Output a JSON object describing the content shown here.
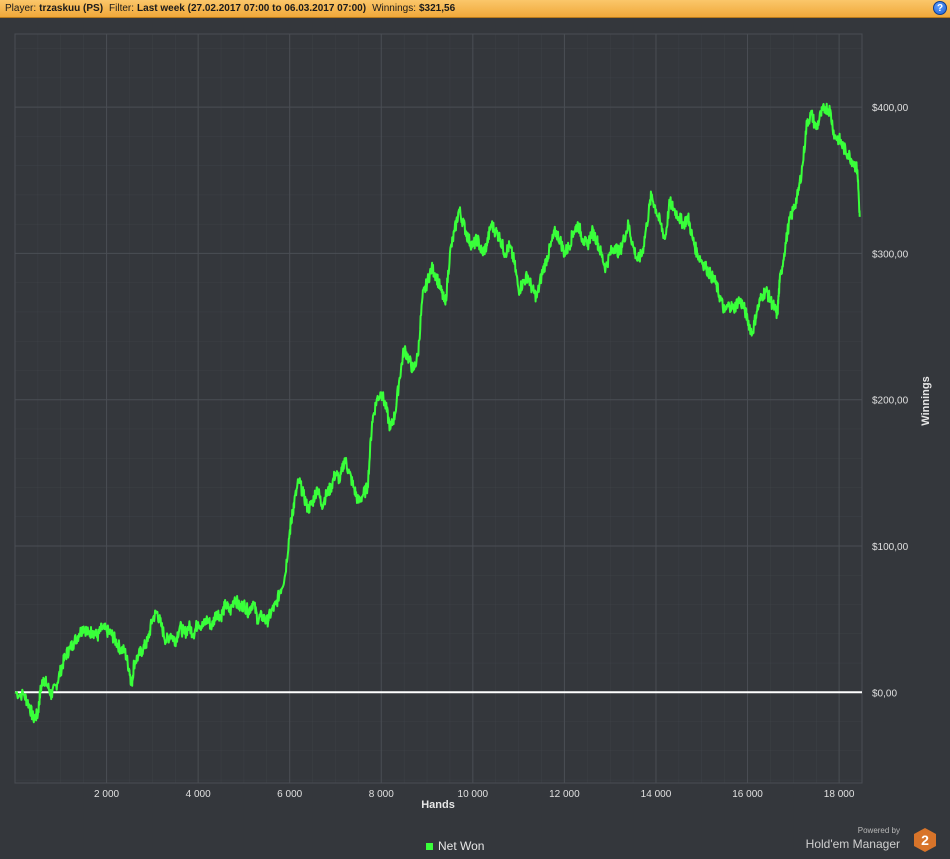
{
  "header": {
    "player_label": "Player:",
    "player_value": "trzaskuu (PS)",
    "filter_label": "Filter:",
    "filter_value": "Last week (27.02.2017 07:00 to 06.03.2017 07:00)",
    "winnings_label": "Winnings:",
    "winnings_value": "$321,56",
    "help_icon": "help-icon",
    "help_glyph": "?"
  },
  "colors": {
    "background": "#34373c",
    "grid": "#4a4e54",
    "line": "#39ff3a",
    "zero_line": "#ffffff",
    "header_bg": "#f0a83a"
  },
  "chart_data": {
    "type": "line",
    "xlabel": "Hands",
    "ylabel": "Winnings",
    "xlim": [
      0,
      18500
    ],
    "ylim": [
      -62,
      450
    ],
    "x_ticks": [
      2000,
      4000,
      6000,
      8000,
      10000,
      12000,
      14000,
      16000,
      18000
    ],
    "x_tick_labels": [
      "2 000",
      "4 000",
      "6 000",
      "8 000",
      "10 000",
      "12 000",
      "14 000",
      "16 000",
      "18 000"
    ],
    "y_ticks": [
      0,
      100,
      200,
      300,
      400
    ],
    "y_tick_labels": [
      "$0,00",
      "$100,00",
      "$200,00",
      "$300,00",
      "$400,00"
    ],
    "grid": true,
    "legend_position": "bottom-center",
    "series": [
      {
        "name": "Net Won",
        "color": "#39ff3a",
        "points": [
          [
            0,
            0
          ],
          [
            200,
            -2
          ],
          [
            300,
            -8
          ],
          [
            400,
            -18
          ],
          [
            500,
            -15
          ],
          [
            550,
            0
          ],
          [
            620,
            10
          ],
          [
            700,
            5
          ],
          [
            800,
            -2
          ],
          [
            900,
            5
          ],
          [
            1000,
            15
          ],
          [
            1100,
            25
          ],
          [
            1200,
            30
          ],
          [
            1300,
            35
          ],
          [
            1400,
            40
          ],
          [
            1500,
            45
          ],
          [
            1600,
            40
          ],
          [
            1700,
            42
          ],
          [
            1800,
            38
          ],
          [
            1900,
            44
          ],
          [
            2000,
            42
          ],
          [
            2100,
            40
          ],
          [
            2200,
            35
          ],
          [
            2300,
            30
          ],
          [
            2400,
            28
          ],
          [
            2500,
            15
          ],
          [
            2550,
            5
          ],
          [
            2600,
            20
          ],
          [
            2700,
            25
          ],
          [
            2800,
            30
          ],
          [
            2900,
            35
          ],
          [
            3000,
            50
          ],
          [
            3100,
            55
          ],
          [
            3200,
            45
          ],
          [
            3300,
            35
          ],
          [
            3400,
            40
          ],
          [
            3500,
            35
          ],
          [
            3600,
            45
          ],
          [
            3700,
            40
          ],
          [
            3800,
            45
          ],
          [
            3900,
            40
          ],
          [
            4000,
            48
          ],
          [
            4100,
            45
          ],
          [
            4200,
            50
          ],
          [
            4300,
            45
          ],
          [
            4400,
            55
          ],
          [
            4500,
            52
          ],
          [
            4600,
            60
          ],
          [
            4700,
            55
          ],
          [
            4800,
            65
          ],
          [
            4900,
            58
          ],
          [
            5000,
            60
          ],
          [
            5100,
            55
          ],
          [
            5200,
            62
          ],
          [
            5300,
            50
          ],
          [
            5400,
            52
          ],
          [
            5500,
            48
          ],
          [
            5600,
            55
          ],
          [
            5700,
            60
          ],
          [
            5800,
            70
          ],
          [
            5900,
            80
          ],
          [
            6000,
            110
          ],
          [
            6050,
            120
          ],
          [
            6100,
            130
          ],
          [
            6200,
            145
          ],
          [
            6300,
            135
          ],
          [
            6400,
            125
          ],
          [
            6500,
            130
          ],
          [
            6600,
            140
          ],
          [
            6700,
            128
          ],
          [
            6800,
            135
          ],
          [
            6900,
            140
          ],
          [
            7000,
            150
          ],
          [
            7100,
            145
          ],
          [
            7200,
            160
          ],
          [
            7300,
            150
          ],
          [
            7400,
            140
          ],
          [
            7500,
            130
          ],
          [
            7600,
            135
          ],
          [
            7700,
            140
          ],
          [
            7800,
            185
          ],
          [
            7900,
            200
          ],
          [
            8000,
            205
          ],
          [
            8100,
            195
          ],
          [
            8200,
            180
          ],
          [
            8300,
            190
          ],
          [
            8400,
            215
          ],
          [
            8500,
            235
          ],
          [
            8600,
            228
          ],
          [
            8700,
            220
          ],
          [
            8800,
            230
          ],
          [
            8900,
            270
          ],
          [
            9000,
            280
          ],
          [
            9100,
            290
          ],
          [
            9200,
            285
          ],
          [
            9300,
            275
          ],
          [
            9400,
            265
          ],
          [
            9500,
            300
          ],
          [
            9600,
            315
          ],
          [
            9700,
            330
          ],
          [
            9800,
            320
          ],
          [
            9900,
            310
          ],
          [
            10000,
            305
          ],
          [
            10100,
            310
          ],
          [
            10200,
            300
          ],
          [
            10300,
            305
          ],
          [
            10400,
            320
          ],
          [
            10500,
            315
          ],
          [
            10600,
            310
          ],
          [
            10700,
            300
          ],
          [
            10800,
            305
          ],
          [
            10900,
            295
          ],
          [
            11000,
            275
          ],
          [
            11100,
            280
          ],
          [
            11200,
            285
          ],
          [
            11300,
            275
          ],
          [
            11400,
            270
          ],
          [
            11500,
            285
          ],
          [
            11600,
            295
          ],
          [
            11700,
            305
          ],
          [
            11800,
            315
          ],
          [
            11900,
            310
          ],
          [
            12000,
            300
          ],
          [
            12100,
            305
          ],
          [
            12200,
            315
          ],
          [
            12300,
            320
          ],
          [
            12400,
            310
          ],
          [
            12500,
            305
          ],
          [
            12600,
            315
          ],
          [
            12700,
            310
          ],
          [
            12800,
            300
          ],
          [
            12900,
            290
          ],
          [
            13000,
            300
          ],
          [
            13100,
            305
          ],
          [
            13200,
            300
          ],
          [
            13300,
            310
          ],
          [
            13400,
            320
          ],
          [
            13500,
            305
          ],
          [
            13600,
            295
          ],
          [
            13700,
            300
          ],
          [
            13800,
            320
          ],
          [
            13900,
            340
          ],
          [
            14000,
            330
          ],
          [
            14100,
            320
          ],
          [
            14200,
            310
          ],
          [
            14300,
            335
          ],
          [
            14400,
            330
          ],
          [
            14500,
            325
          ],
          [
            14600,
            320
          ],
          [
            14700,
            325
          ],
          [
            14800,
            310
          ],
          [
            14900,
            300
          ],
          [
            15000,
            295
          ],
          [
            15100,
            290
          ],
          [
            15200,
            285
          ],
          [
            15300,
            280
          ],
          [
            15400,
            270
          ],
          [
            15500,
            260
          ],
          [
            15600,
            265
          ],
          [
            15700,
            262
          ],
          [
            15800,
            268
          ],
          [
            15900,
            265
          ],
          [
            16000,
            255
          ],
          [
            16100,
            245
          ],
          [
            16200,
            260
          ],
          [
            16300,
            270
          ],
          [
            16400,
            275
          ],
          [
            16500,
            268
          ],
          [
            16600,
            262
          ],
          [
            16650,
            258
          ],
          [
            16700,
            280
          ],
          [
            16800,
            300
          ],
          [
            16900,
            320
          ],
          [
            17000,
            330
          ],
          [
            17100,
            340
          ],
          [
            17200,
            360
          ],
          [
            17300,
            390
          ],
          [
            17400,
            395
          ],
          [
            17500,
            385
          ],
          [
            17600,
            395
          ],
          [
            17700,
            400
          ],
          [
            17800,
            398
          ],
          [
            17900,
            380
          ],
          [
            18000,
            378
          ],
          [
            18100,
            372
          ],
          [
            18200,
            368
          ],
          [
            18300,
            363
          ],
          [
            18400,
            357
          ],
          [
            18450,
            325
          ]
        ]
      }
    ]
  },
  "legend": {
    "items": [
      {
        "label": "Net Won"
      }
    ]
  },
  "branding": {
    "powered_by": "Powered by",
    "product": "Hold'em Manager",
    "logo_number": "2"
  }
}
